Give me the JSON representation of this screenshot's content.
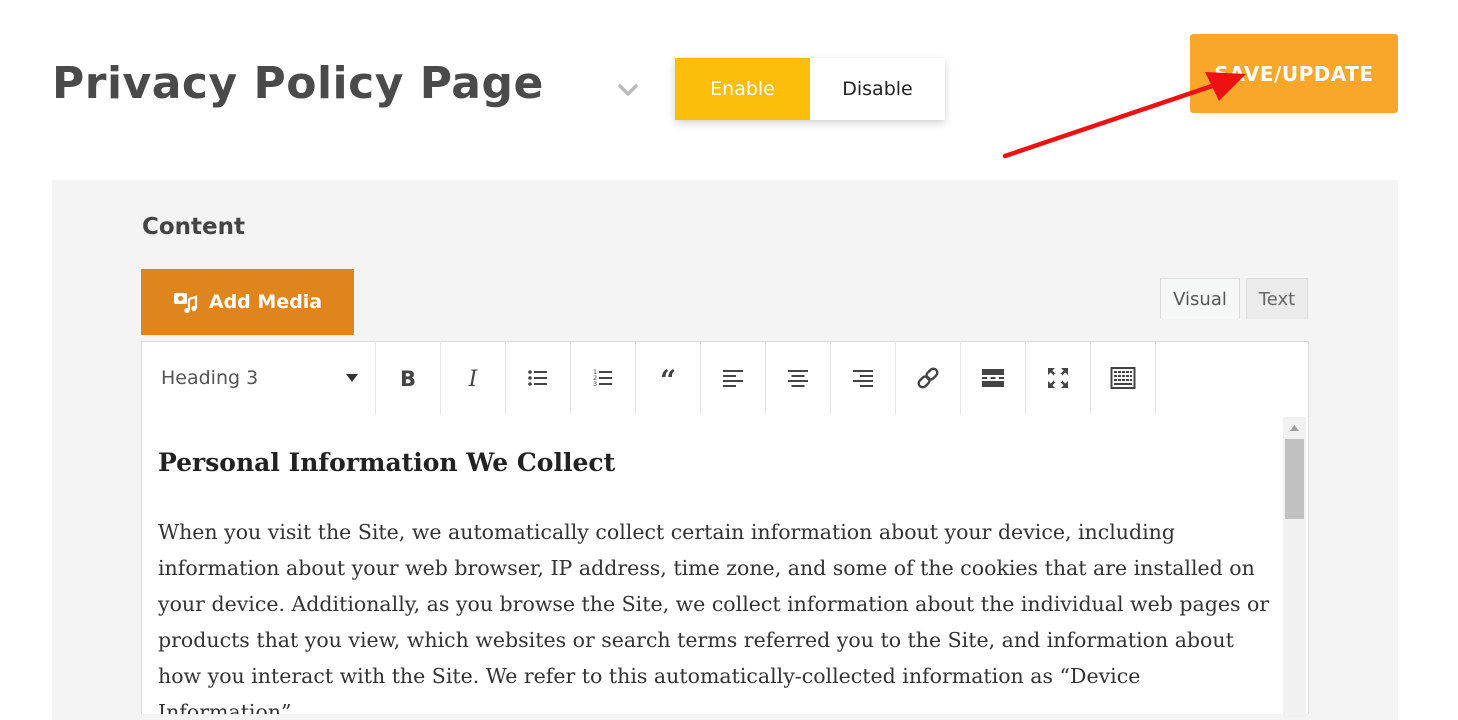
{
  "page": {
    "title": "Privacy Policy Page"
  },
  "status_toggle": {
    "enable_label": "Enable",
    "disable_label": "Disable",
    "selected": "Enable"
  },
  "save_button": {
    "label": "SAVE/UPDATE"
  },
  "content_section": {
    "label": "Content",
    "add_media_label": "Add Media"
  },
  "editor": {
    "tabs": [
      {
        "label": "Visual",
        "active": true
      },
      {
        "label": "Text",
        "active": false
      }
    ],
    "format_select": {
      "value": "Heading 3"
    },
    "toolbar_icons": [
      "bold-icon",
      "italic-icon",
      "bulleted-list-icon",
      "numbered-list-icon",
      "blockquote-icon",
      "align-left-icon",
      "align-center-icon",
      "align-right-icon",
      "link-icon",
      "read-more-icon",
      "fullscreen-icon",
      "toolbar-toggle-icon"
    ],
    "document": {
      "heading": "Personal Information We Collect",
      "paragraph": "When you visit the Site, we automatically collect certain information about your device, including information about your web browser, IP address, time zone, and some of the cookies that are installed on your device. Additionally, as you browse the Site, we collect information about the individual web pages or products that you view, which websites or search terms referred you to the Site, and information about how you interact with the Site. We refer to this automatically-collected information as “Device Information”."
    }
  },
  "colors": {
    "enable_active": "#fcbd0b",
    "save_button": "#f9a72b",
    "add_media": "#de861d",
    "panel_background": "#f4f4f4",
    "annotation_arrow": "#ee1111"
  }
}
